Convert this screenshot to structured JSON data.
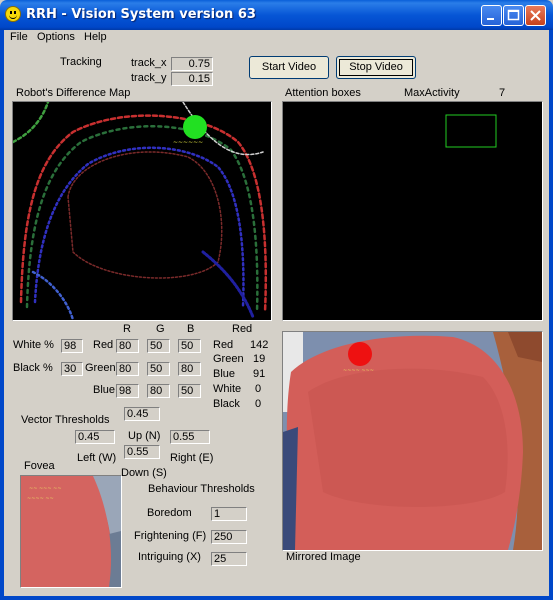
{
  "window": {
    "title": "RRH - Vision System version 63"
  },
  "menu": [
    "File",
    "Options",
    "Help"
  ],
  "tracking": {
    "label": "Tracking",
    "track_x_label": "track_x",
    "track_x": "0.75",
    "track_y_label": "track_y",
    "track_y": "0.15"
  },
  "buttons": {
    "start": "Start Video",
    "stop": "Stop Video"
  },
  "diff_map": {
    "title": "Robot's Difference Map"
  },
  "attention": {
    "title": "Attention boxes",
    "max_label": "MaxActivity",
    "max_value": "7"
  },
  "rgb_headers": {
    "r": "R",
    "g": "G",
    "b": "B"
  },
  "white": {
    "label": "White %",
    "value": "98"
  },
  "black": {
    "label": "Black %",
    "value": "30"
  },
  "color_rows": [
    {
      "label": "Red",
      "r": "80",
      "g": "50",
      "b": "50"
    },
    {
      "label": "Green",
      "r": "80",
      "g": "50",
      "b": "80"
    },
    {
      "label": "Blue",
      "r": "98",
      "g": "80",
      "b": "50"
    }
  ],
  "red_stats": {
    "title": "Red",
    "rows": [
      {
        "label": "Red",
        "value": "142"
      },
      {
        "label": "Green",
        "value": "19"
      },
      {
        "label": "Blue",
        "value": "91"
      },
      {
        "label": "White",
        "value": "0"
      },
      {
        "label": "Black",
        "value": "0"
      }
    ]
  },
  "vector": {
    "title": "Vector Thresholds",
    "top": "0.45",
    "left": "0.45",
    "up_label": "Up (N)",
    "right": "0.55",
    "down": "0.55",
    "left_label": "Left (W)",
    "right_label": "Right (E)",
    "down_label": "Down (S)"
  },
  "fovea": {
    "title": "Fovea"
  },
  "behaviour": {
    "title": "Behaviour Thresholds",
    "rows": [
      {
        "label": "Boredom",
        "value": "1"
      },
      {
        "label": "Frightening (F)",
        "value": "250"
      },
      {
        "label": "Intriguing (X)",
        "value": "25"
      }
    ]
  },
  "mirrored": {
    "title": "Mirrored Image"
  },
  "colors": {
    "accent": "#0047c9",
    "marker_green": "#22e022",
    "marker_red": "#ee1111",
    "attention_box": "#22cc22"
  }
}
